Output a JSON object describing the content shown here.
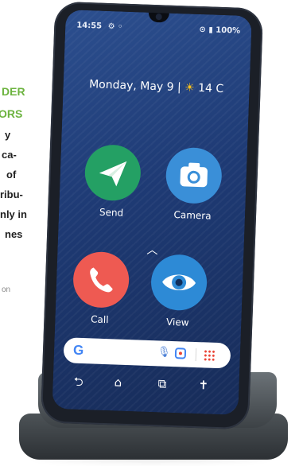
{
  "article": {
    "headline": [
      "DER",
      "ORS"
    ],
    "body_lines": [
      "y",
      "ca-",
      "of",
      "ribu-",
      "nly in",
      "nes"
    ],
    "caption": "on"
  },
  "phone": {
    "status_time": "14:55",
    "status_icons_left": "⚙ ◦",
    "status_right": "⊙ ▮ 100%",
    "date_text": "Monday, May 9 |",
    "weather_icon": "sun-icon",
    "weather_text": "14 C",
    "apps": [
      {
        "label": "Send",
        "icon": "paper-plane-icon",
        "color": "#24a064"
      },
      {
        "label": "Camera",
        "icon": "camera-icon",
        "color": "#3a8fd8"
      },
      {
        "label": "Call",
        "icon": "phone-handset-icon",
        "color": "#ee5a52"
      },
      {
        "label": "View",
        "icon": "eye-icon",
        "color": "#2d8ad6"
      }
    ],
    "search_logo": "G",
    "nav": {
      "back": "⮌",
      "home": "⌂",
      "recents": "⧉",
      "assist": "✝"
    }
  }
}
